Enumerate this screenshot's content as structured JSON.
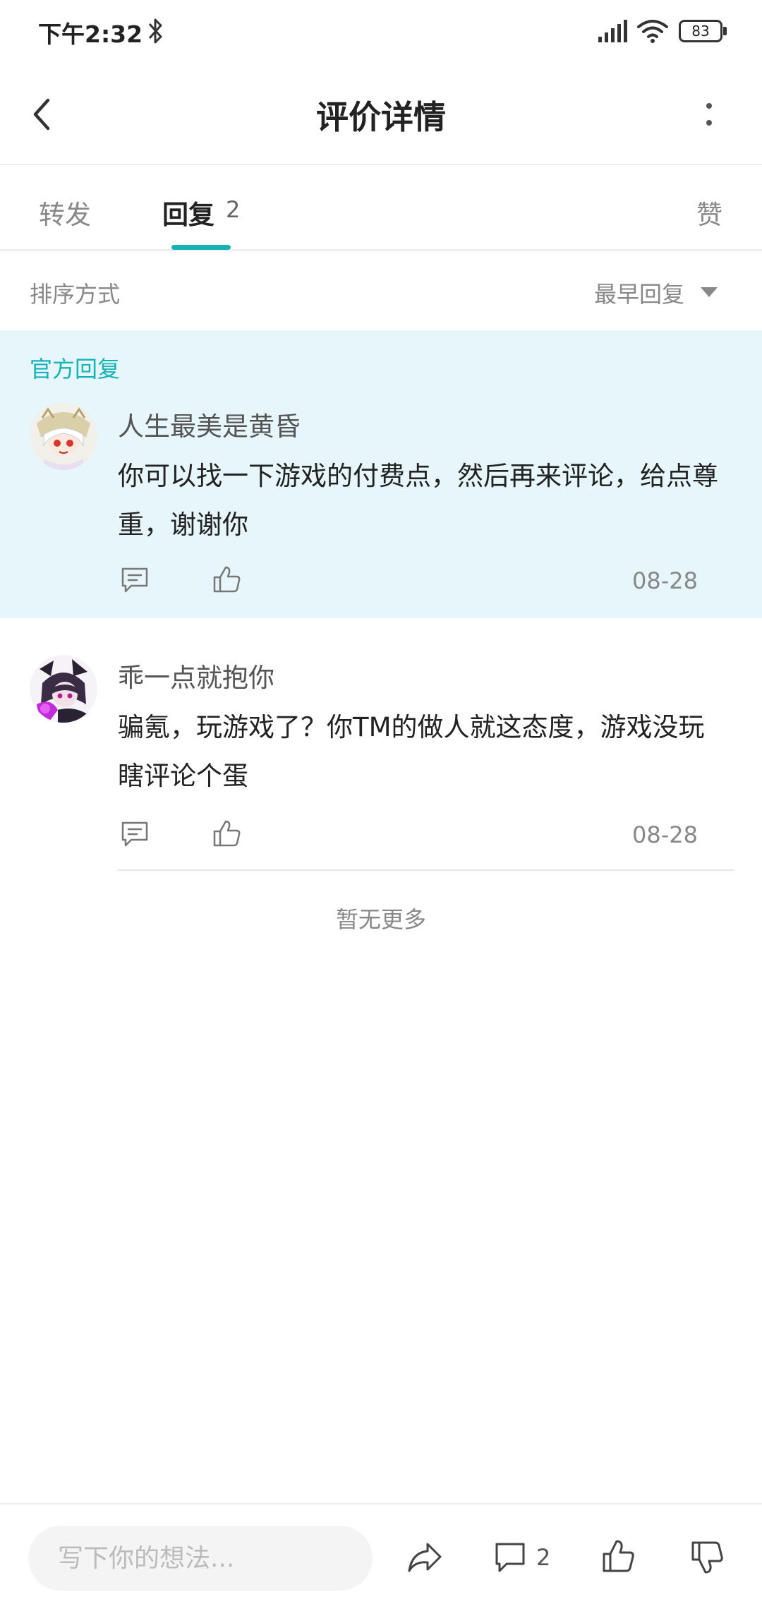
{
  "status_bar": {
    "time": "下午2:32",
    "battery": "83"
  },
  "header": {
    "title": "评价详情"
  },
  "tabs": [
    {
      "label": "转发"
    },
    {
      "label": "回复",
      "count": "2",
      "active": true
    },
    {
      "label": "赞"
    }
  ],
  "sort": {
    "label": "排序方式",
    "value": "最早回复"
  },
  "comments": [
    {
      "tag": "官方回复",
      "username": "人生最美是黄昏",
      "text": "你可以找一下游戏的付费点，然后再来评论，给点尊重，谢谢你",
      "date": "08-28",
      "avatar_icon": "anime-girl-white-avatar"
    },
    {
      "username": "乖一点就抱你",
      "text": "骗氪，玩游戏了？你TM的做人就这态度，游戏没玩瞎评论个蛋",
      "date": "08-28",
      "avatar_icon": "anime-girl-dark-avatar"
    }
  ],
  "footer_text": "暂无更多",
  "bottom_bar": {
    "input_placeholder": "写下你的想法...",
    "comment_count": "2"
  },
  "colors": {
    "accent": "#15b2b8",
    "official_bg": "#e6f6fa",
    "muted_text": "#888888"
  }
}
